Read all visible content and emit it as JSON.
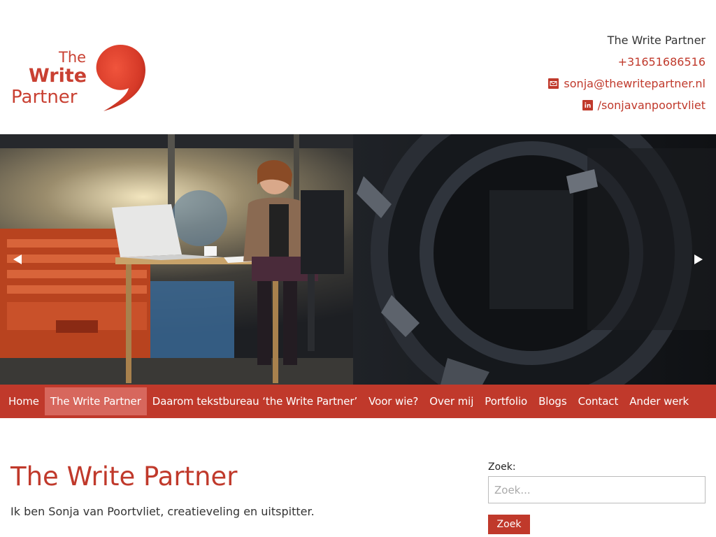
{
  "site": {
    "logo_line1": "The",
    "logo_line2": "Write",
    "logo_line3": "Partner"
  },
  "contact": {
    "title": "The Write Partner",
    "phone": "+31651686516",
    "email": "sonja@thewritepartner.nl",
    "linkedin": "/sonjavanpoortvliet"
  },
  "nav": {
    "items": [
      {
        "label": "Home"
      },
      {
        "label": "The Write Partner"
      },
      {
        "label": "Daarom tekstbureau ‘the Write Partner’"
      },
      {
        "label": "Voor wie?"
      },
      {
        "label": "Over mij"
      },
      {
        "label": "Portfolio"
      },
      {
        "label": "Blogs"
      },
      {
        "label": "Contact"
      },
      {
        "label": "Ander werk"
      }
    ],
    "active_index": 1
  },
  "main": {
    "title": "The Write Partner",
    "intro": "Ik ben Sonja van Poortvliet, creatieveling en uitspitter."
  },
  "search": {
    "label": "Zoek:",
    "placeholder": "Zoek...",
    "button_label": "Zoek"
  },
  "colors": {
    "accent": "#c0392b",
    "active_nav": "#d7675d"
  },
  "icons": {
    "email": "envelope-icon",
    "linkedin": "linkedin-icon",
    "prev": "triangle-left-icon",
    "next": "triangle-right-icon"
  }
}
